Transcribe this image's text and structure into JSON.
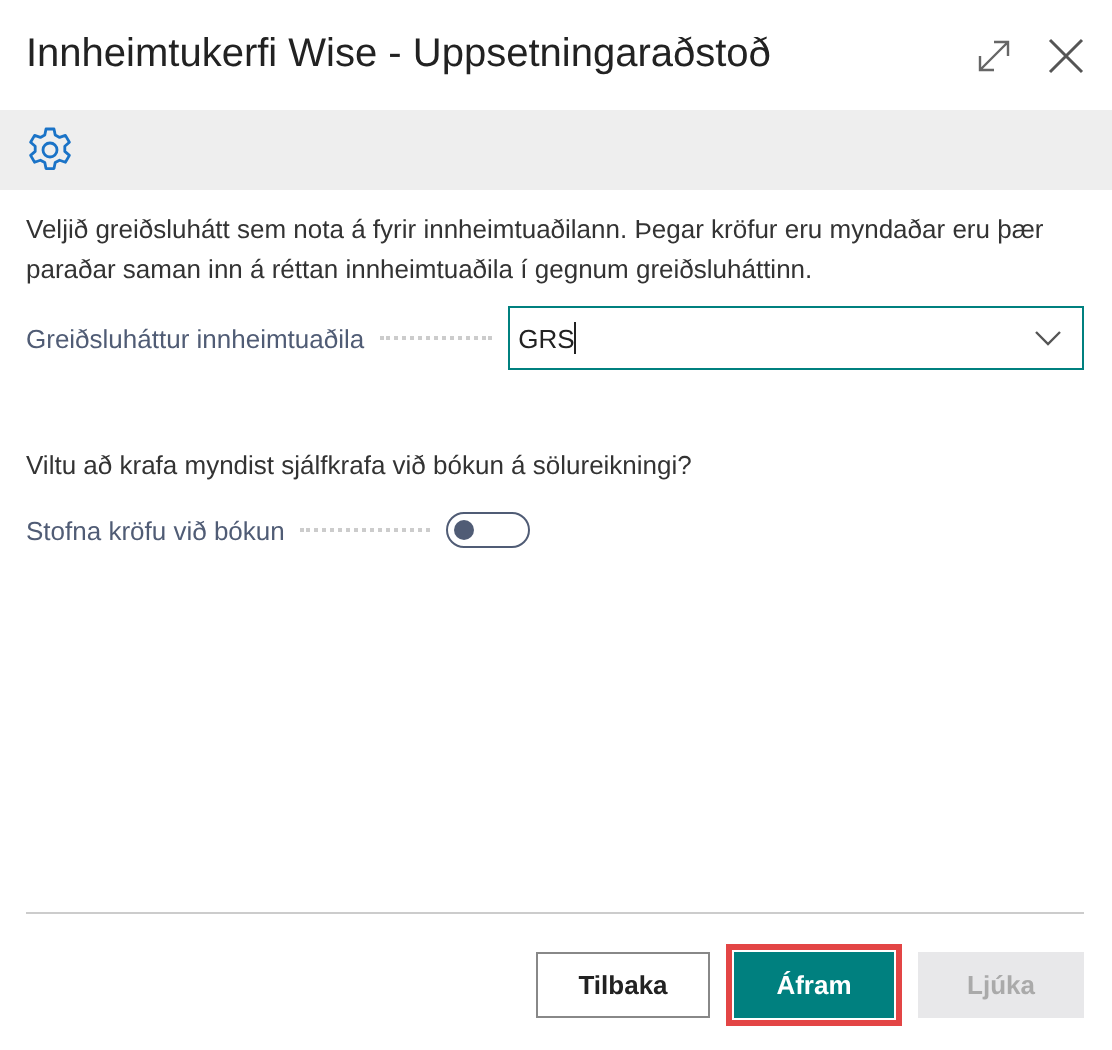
{
  "window": {
    "title": "Innheimtukerfi Wise - Uppsetningaraðstoð"
  },
  "intro": "Veljið greiðsluhátt sem nota á fyrir innheimtuaðilann. Þegar kröfur eru myndaðar eru þær paraðar saman inn á réttan innheimtuaðila í gegnum greiðsluháttinn.",
  "payment_field": {
    "label": "Greiðsluháttur innheimtuaðila",
    "value": "GRS"
  },
  "question": "Viltu að krafa myndist sjálfkrafa við bókun á sölureikningi?",
  "toggle_field": {
    "label": "Stofna kröfu við bókun",
    "on": false
  },
  "buttons": [
    {
      "label": "Tilbaka",
      "kind": "secondary",
      "disabled": false,
      "highlighted": false
    },
    {
      "label": "Áfram",
      "kind": "primary",
      "disabled": false,
      "highlighted": true
    },
    {
      "label": "Ljúka",
      "kind": "primary",
      "disabled": true,
      "highlighted": false
    }
  ]
}
